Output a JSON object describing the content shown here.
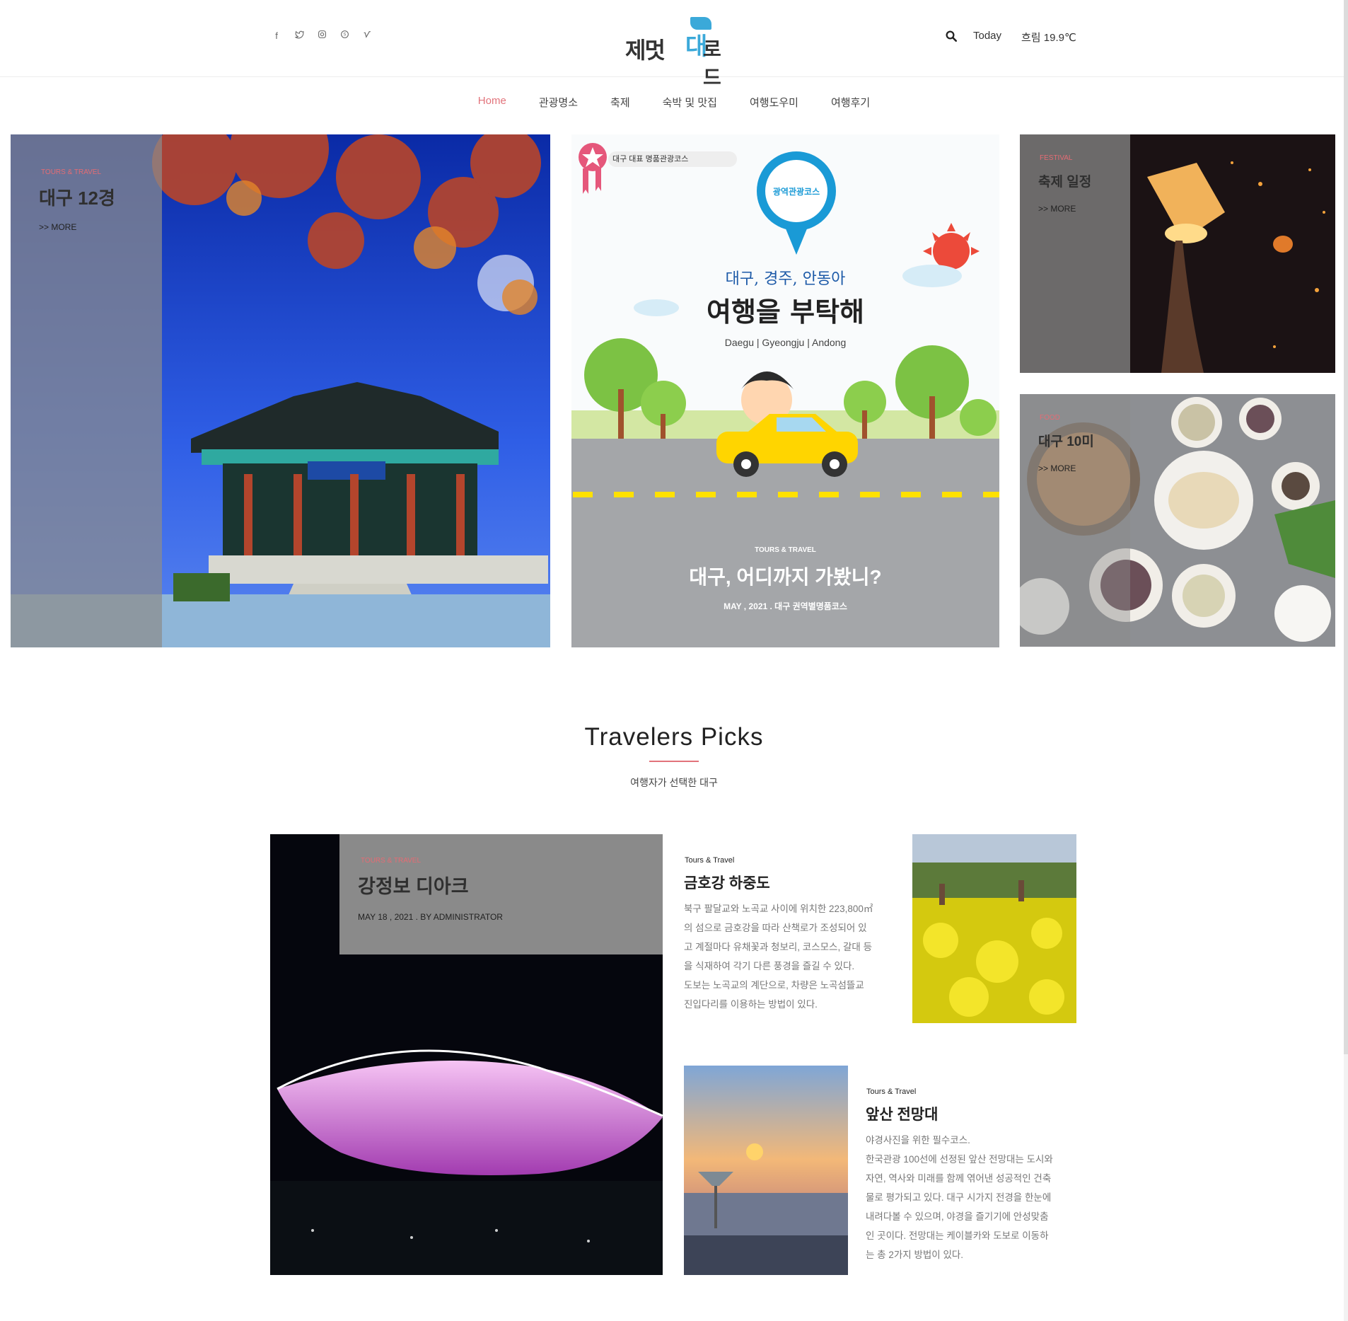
{
  "header": {
    "social_icons": [
      "facebook-icon",
      "twitter-icon",
      "instagram-icon",
      "skype-icon",
      "vimeo-icon"
    ],
    "logo": {
      "part1": "제멋",
      "part2": "대",
      "part3": "로드"
    },
    "today_label": "Today",
    "weather": "흐림 19.9℃"
  },
  "nav": {
    "items": [
      "Home",
      "관광명소",
      "축제",
      "숙박 및 맛집",
      "여행도우미",
      "여행후기"
    ],
    "active": "Home"
  },
  "hero": {
    "left": {
      "category": "TOURS & TRAVEL",
      "title": "대구 12경",
      "more": ">> MORE"
    },
    "center": {
      "badge": "대구 대표 명품관광코스",
      "pin_label": "광역관광코스",
      "headline1": "대구, 경주, 안동아",
      "headline2": "여행을 부탁해",
      "subline": "Daegu | Gyeongju | Andong",
      "category": "TOURS & TRAVEL",
      "title": "대구, 어디까지 가봤니?",
      "meta": "MAY , 2021 . 대구 권역별명품코스"
    },
    "right_top": {
      "category": "FESTIVAL",
      "title": "축제 일정",
      "more": ">> MORE"
    },
    "right_bottom": {
      "category": "FOOD",
      "title": "대구 10미",
      "more": ">> MORE"
    }
  },
  "picks": {
    "title": "Travelers Picks",
    "subtitle": "여행자가 선택한 대구",
    "feature": {
      "category": "TOURS & TRAVEL",
      "title": "강정보 디아크",
      "meta": "MAY 18 , 2021 . BY ADMINISTRATOR"
    },
    "item1": {
      "category": "Tours & Travel",
      "title": "금호강 하중도",
      "lines": [
        "북구 팔달교와 노곡교 사이에 위치한 223,800㎡",
        "의 섬으로 금호강을 따라 산책로가 조성되어 있",
        "고 계절마다 유채꽃과 청보리, 코스모스, 갈대 등",
        "을 식재하여 각기 다른 풍경을 즐길 수 있다.",
        "도보는 노곡교의 계단으로, 차량은 노곡섬뜰교",
        "진입다리를 이용하는 방법이 있다."
      ]
    },
    "item2": {
      "category": "Tours & Travel",
      "title": "앞산 전망대",
      "lines": [
        "야경사진을 위한 필수코스.",
        "한국관광 100선에 선정된 앞산 전망대는 도시와",
        "자연, 역사와 미래를 함께 엮어낸 성공적인 건축",
        "물로 평가되고 있다. 대구 시가지 전경을 한눈에",
        "내려다볼 수 있으며, 야경을 즐기기에 안성맞춤",
        "인 곳이다. 전망대는 케이블카와 도보로 이동하",
        "는 총 2가지 방법이 있다."
      ]
    }
  },
  "colors": {
    "accent": "#e2737b",
    "overlay": "#8c8c8c",
    "link_blue": "#3ba9d9"
  }
}
